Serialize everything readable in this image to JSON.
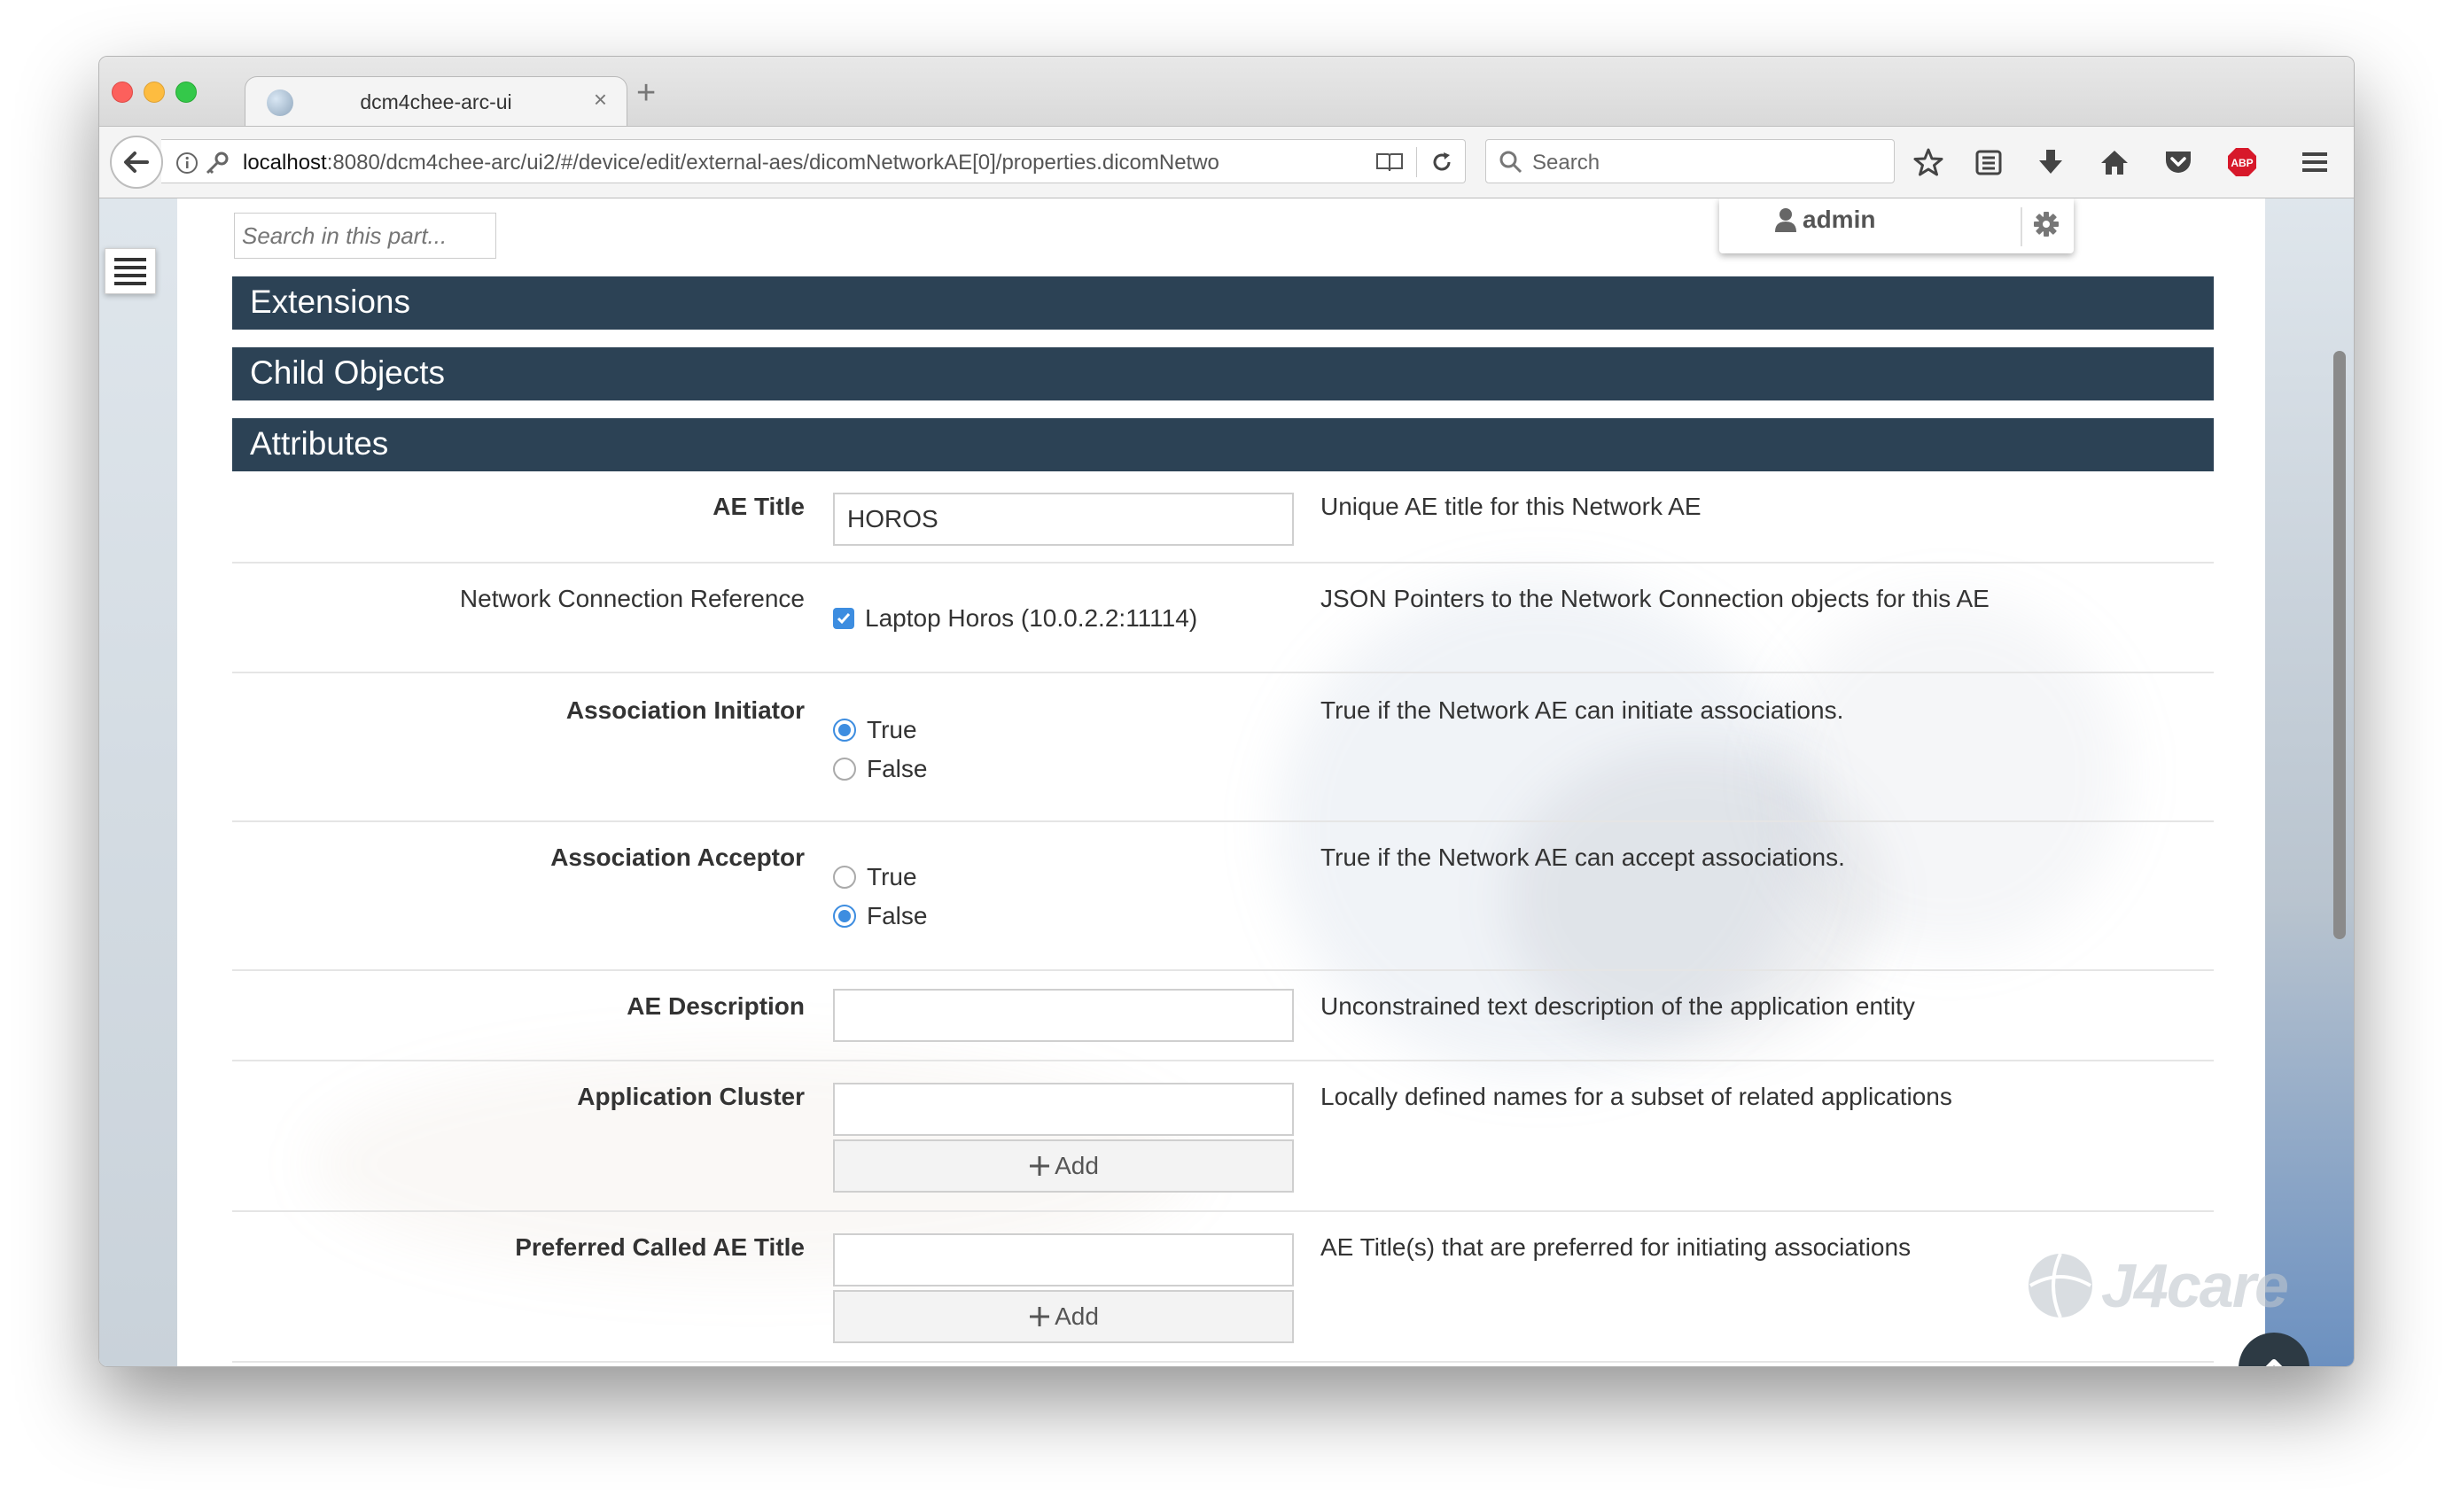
{
  "browser": {
    "tab_title": "dcm4chee-arc-ui",
    "tab_close": "×",
    "new_tab": "+",
    "url_host": "localhost",
    "url_rest": ":8080/dcm4chee-arc/ui2/#/device/edit/external-aes/dicomNetworkAE[0]/properties.dicomNetwo",
    "search_placeholder": "Search",
    "abp_label": "ABP"
  },
  "header": {
    "search_part_placeholder": "Search in this part...",
    "user": "admin"
  },
  "sections": {
    "extensions": "Extensions",
    "child_objects": "Child Objects",
    "attributes": "Attributes"
  },
  "fields": {
    "ae_title": {
      "label": "AE Title",
      "value": "HOROS",
      "desc": "Unique AE title for this Network AE"
    },
    "network_connection": {
      "label": "Network Connection Reference",
      "option": "Laptop Horos (10.0.2.2:11114)",
      "desc": "JSON Pointers to the Network Connection objects for this AE"
    },
    "assoc_initiator": {
      "label": "Association Initiator",
      "true_label": "True",
      "false_label": "False",
      "selected": "True",
      "desc": "True if the Network AE can initiate associations."
    },
    "assoc_acceptor": {
      "label": "Association Acceptor",
      "true_label": "True",
      "false_label": "False",
      "selected": "False",
      "desc": "True if the Network AE can accept associations."
    },
    "ae_description": {
      "label": "AE Description",
      "value": "",
      "desc": "Unconstrained text description of the application entity"
    },
    "app_cluster": {
      "label": "Application Cluster",
      "value": "",
      "add_label": "Add",
      "desc": "Locally defined names for a subset of related applications"
    },
    "preferred_called": {
      "label": "Preferred Called AE Title",
      "value": "",
      "add_label": "Add",
      "desc": "AE Title(s) that are preferred for initiating associations"
    }
  },
  "watermark": "J4care",
  "colors": {
    "section_bar": "#2c4255",
    "accent": "#3d8de0"
  }
}
